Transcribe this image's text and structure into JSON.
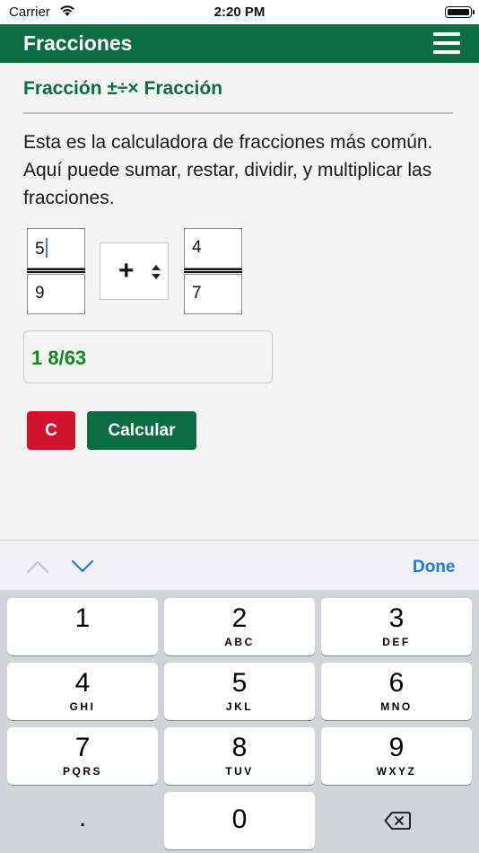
{
  "status_bar": {
    "carrier": "Carrier",
    "time": "2:20 PM",
    "wifi_icon": "wifi-icon",
    "battery_icon": "battery-icon"
  },
  "header": {
    "title": "Fracciones",
    "menu_icon": "hamburger-menu-icon"
  },
  "section": {
    "title": "Fracción ±÷× Fracción",
    "description": "Esta es la calculadora de fracciones más común. Aquí puede sumar, restar, dividir, y multiplicar las fracciones."
  },
  "fraction1": {
    "numerator": "5",
    "denominator": "9"
  },
  "operator": {
    "selected": "+"
  },
  "fraction2": {
    "numerator": "4",
    "denominator": "7"
  },
  "result": {
    "value": "1 8/63"
  },
  "buttons": {
    "clear": "C",
    "calculate": "Calcular"
  },
  "accessory": {
    "prev_icon": "chevron-up-icon",
    "next_icon": "chevron-down-icon",
    "done": "Done"
  },
  "keypad": {
    "keys": [
      {
        "digit": "1",
        "letters": ""
      },
      {
        "digit": "2",
        "letters": "ABC"
      },
      {
        "digit": "3",
        "letters": "DEF"
      },
      {
        "digit": "4",
        "letters": "GHI"
      },
      {
        "digit": "5",
        "letters": "JKL"
      },
      {
        "digit": "6",
        "letters": "MNO"
      },
      {
        "digit": "7",
        "letters": "PQRS"
      },
      {
        "digit": "8",
        "letters": "TUV"
      },
      {
        "digit": "9",
        "letters": "WXYZ"
      }
    ],
    "dot": ".",
    "zero": "0",
    "backspace_icon": "backspace-icon"
  },
  "colors": {
    "brand_green": "#0d6d42",
    "result_green": "#128a1e",
    "clear_red": "#d0142d",
    "link_blue": "#1a7ee0"
  }
}
